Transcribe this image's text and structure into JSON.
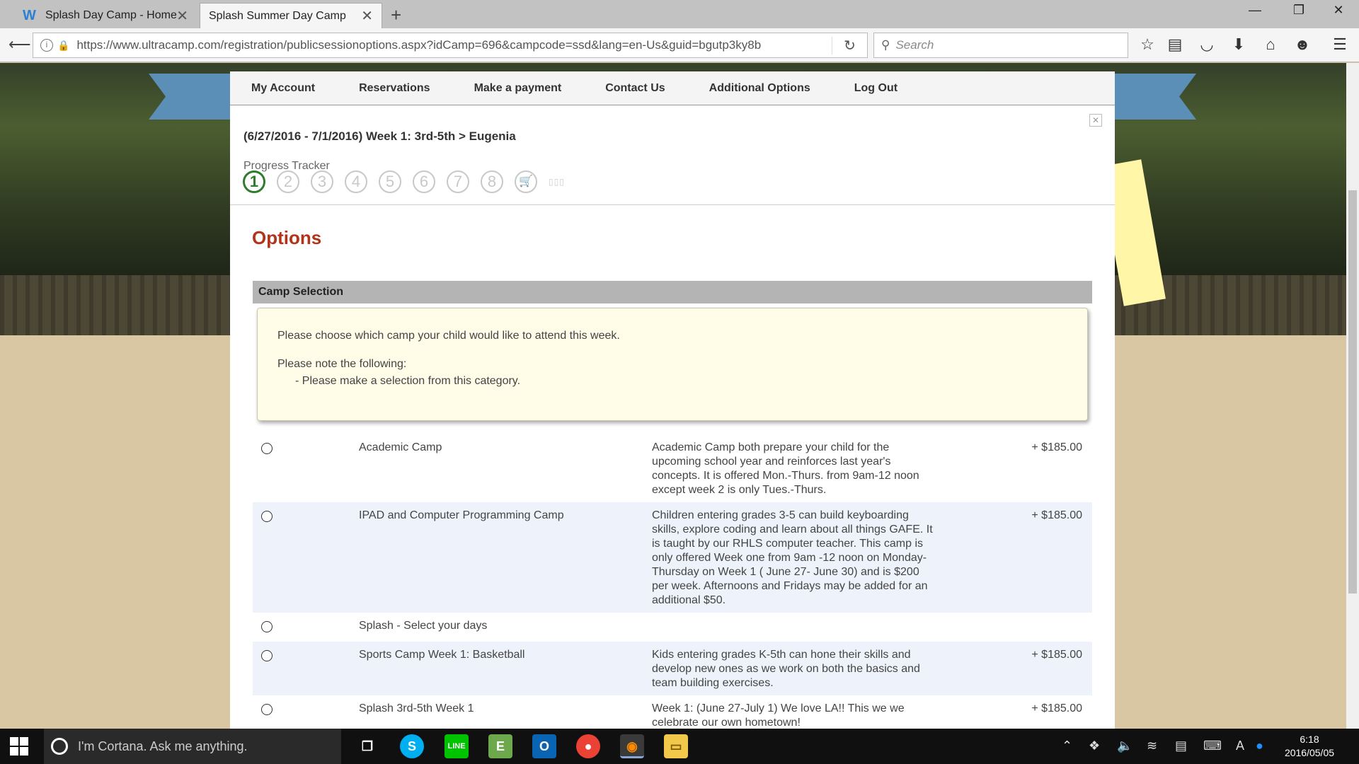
{
  "browser": {
    "tabs": [
      {
        "title": "Splash Day Camp - Home",
        "icon": "w-favicon"
      },
      {
        "title": "Splash Summer Day Camp",
        "icon": "none"
      }
    ],
    "url": "https://www.ultracamp.com/registration/publicsessionoptions.aspx?idCamp=696&campcode=ssd&lang=en-Us&guid=bgutp3ky8b",
    "search_placeholder": "Search"
  },
  "menu": [
    "My Account",
    "Reservations",
    "Make a payment",
    "Contact Us",
    "Additional Options",
    "Log Out"
  ],
  "session_title": "(6/27/2016 - 7/1/2016) Week 1: 3rd-5th > Eugenia",
  "tracker": {
    "label": "Progress Tracker",
    "steps": [
      "1",
      "2",
      "3",
      "4",
      "5",
      "6",
      "7",
      "8"
    ],
    "current_step": 1
  },
  "options_heading": "Options",
  "section_title": "Camp Selection",
  "notice": {
    "line1": "Please choose which camp your child would like to attend this week.",
    "line2": "Please note the following:",
    "line3": "- Please make a selection from this category."
  },
  "options": [
    {
      "name": "Academic Camp",
      "description": "Academic Camp both prepare your child for the upcoming school year and reinforces last year's concepts. It is offered Mon.-Thurs. from 9am-12 noon except week 2 is only Tues.-Thurs.",
      "price": "+ $185.00"
    },
    {
      "name": "IPAD and Computer Programming Camp",
      "description": "Children entering grades 3-5 can build keyboarding skills, explore coding and learn about all things GAFE. It is taught by our RHLS computer teacher. This camp is only offered Week one from 9am -12 noon on Monday-Thursday on Week 1 ( June 27- June 30) and is $200 per week. Afternoons and Fridays may be added for an additional $50.",
      "price": "+ $185.00"
    },
    {
      "name": "Splash - Select your days",
      "description": "",
      "price": ""
    },
    {
      "name": "Sports Camp Week 1: Basketball",
      "description": "Kids entering grades K-5th can hone their skills and develop new ones as we work on both the basics and team building exercises.",
      "price": "+ $185.00"
    },
    {
      "name": "Splash 3rd-5th Week 1",
      "description": "Week 1: (June 27-July 1) We love LA!! This we we celebrate our own hometown!",
      "price": "+ $185.00"
    }
  ],
  "taskbar": {
    "cortana_text": "I'm Cortana. Ask me anything.",
    "time": "6:18",
    "date": "2016/05/05",
    "language_indicator": "A"
  }
}
